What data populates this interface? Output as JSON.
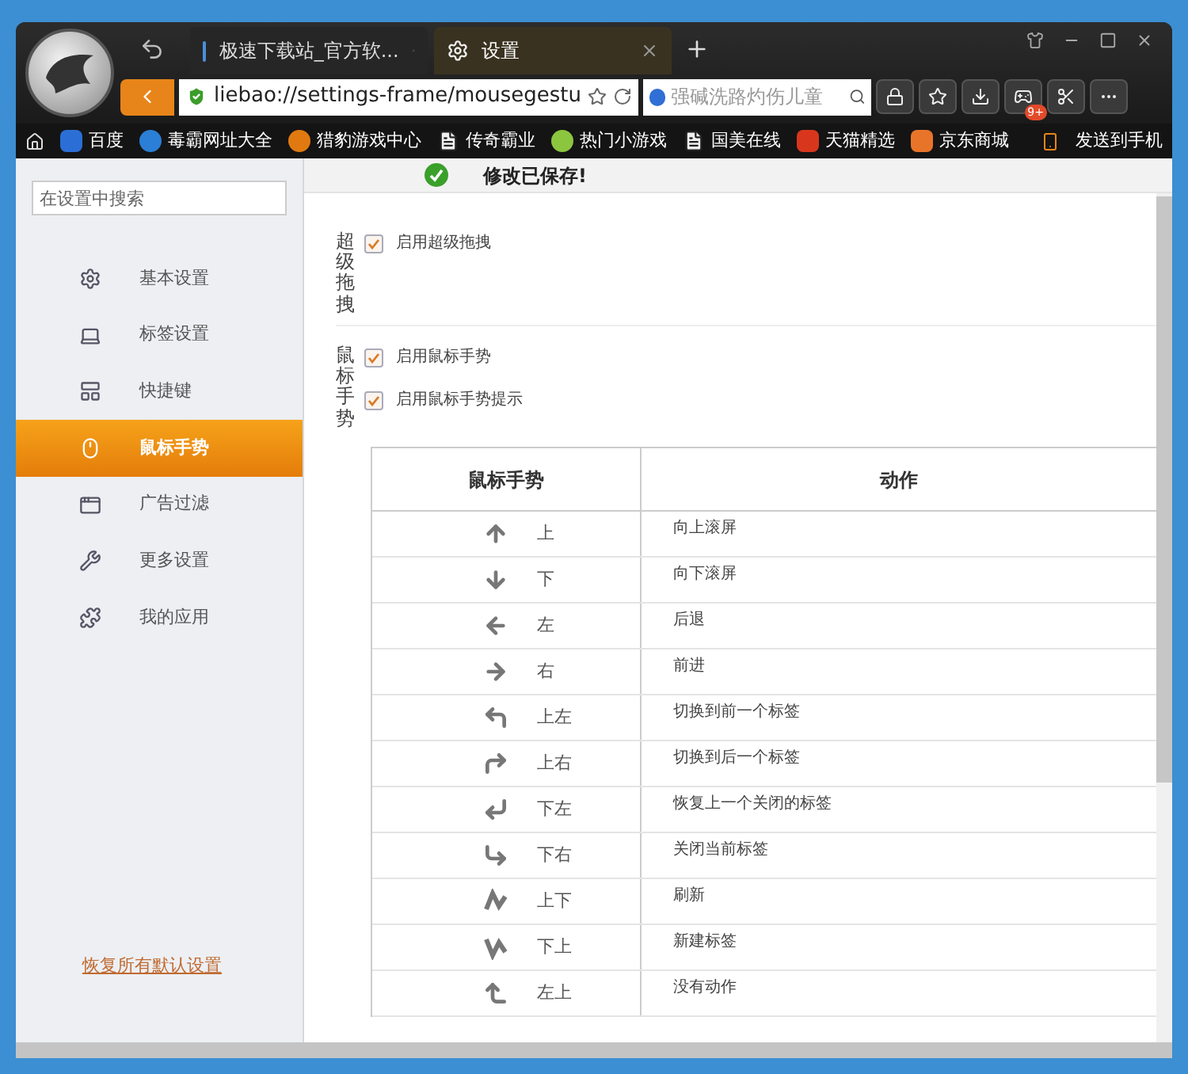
{
  "browser": {
    "tabs": [
      {
        "title": "极速下载站_官方软...",
        "selected": false
      },
      {
        "title": "设置",
        "selected": true
      }
    ],
    "address": "liebao://settings-frame/mousegestu",
    "search_placeholder": "强碱洗路灼伤儿童",
    "badge": "9+",
    "bookmarks": [
      {
        "label": "百度",
        "kind": "square",
        "color": "#2b6fd6"
      },
      {
        "label": "毒霸网址大全",
        "kind": "circle",
        "color": "#2b7fd6"
      },
      {
        "label": "猎豹游戏中心",
        "kind": "circle",
        "color": "#e07a10"
      },
      {
        "label": "传奇霸业",
        "kind": "page",
        "color": "#f0f0f0"
      },
      {
        "label": "热门小游戏",
        "kind": "circle",
        "color": "#8cc63f"
      },
      {
        "label": "国美在线",
        "kind": "page",
        "color": "#f0f0f0"
      },
      {
        "label": "天猫精选",
        "kind": "square",
        "color": "#d9361e"
      },
      {
        "label": "京东商城",
        "kind": "square",
        "color": "#e8742a"
      }
    ],
    "send_to_phone": "发送到手机"
  },
  "sidebar": {
    "search_placeholder": "在设置中搜索",
    "items": [
      {
        "label": "基本设置",
        "kind": "gear",
        "selected": false
      },
      {
        "label": "标签设置",
        "kind": "tab",
        "selected": false
      },
      {
        "label": "快捷键",
        "kind": "keys",
        "selected": false
      },
      {
        "label": "鼠标手势",
        "kind": "mouse",
        "selected": true
      },
      {
        "label": "广告过滤",
        "kind": "window",
        "selected": false
      },
      {
        "label": "更多设置",
        "kind": "wrench",
        "selected": false
      },
      {
        "label": "我的应用",
        "kind": "puzzle",
        "selected": false
      }
    ],
    "reset_link": "恢复所有默认设置"
  },
  "toast": "修改已保存!",
  "sections": [
    {
      "label": "超级拖拽",
      "options": [
        {
          "label": "启用超级拖拽",
          "checked": true
        }
      ]
    },
    {
      "label": "鼠标手势",
      "options": [
        {
          "label": "启用鼠标手势",
          "checked": true
        },
        {
          "label": "启用鼠标手势提示",
          "checked": true
        }
      ]
    }
  ],
  "table": {
    "columns": [
      "鼠标手势",
      "动作"
    ],
    "rows": [
      {
        "kind": "up",
        "gesture": "上",
        "action": "向上滚屏"
      },
      {
        "kind": "down",
        "gesture": "下",
        "action": "向下滚屏"
      },
      {
        "kind": "left",
        "gesture": "左",
        "action": "后退"
      },
      {
        "kind": "right",
        "gesture": "右",
        "action": "前进"
      },
      {
        "kind": "up-left",
        "gesture": "上左",
        "action": "切换到前一个标签"
      },
      {
        "kind": "up-right",
        "gesture": "上右",
        "action": "切换到后一个标签"
      },
      {
        "kind": "down-left",
        "gesture": "下左",
        "action": "恢复上一个关闭的标签"
      },
      {
        "kind": "down-right",
        "gesture": "下右",
        "action": "关闭当前标签"
      },
      {
        "kind": "up-down",
        "gesture": "上下",
        "action": "刷新"
      },
      {
        "kind": "down-up",
        "gesture": "下上",
        "action": "新建标签"
      },
      {
        "kind": "left-up",
        "gesture": "左上",
        "action": "没有动作"
      }
    ]
  }
}
